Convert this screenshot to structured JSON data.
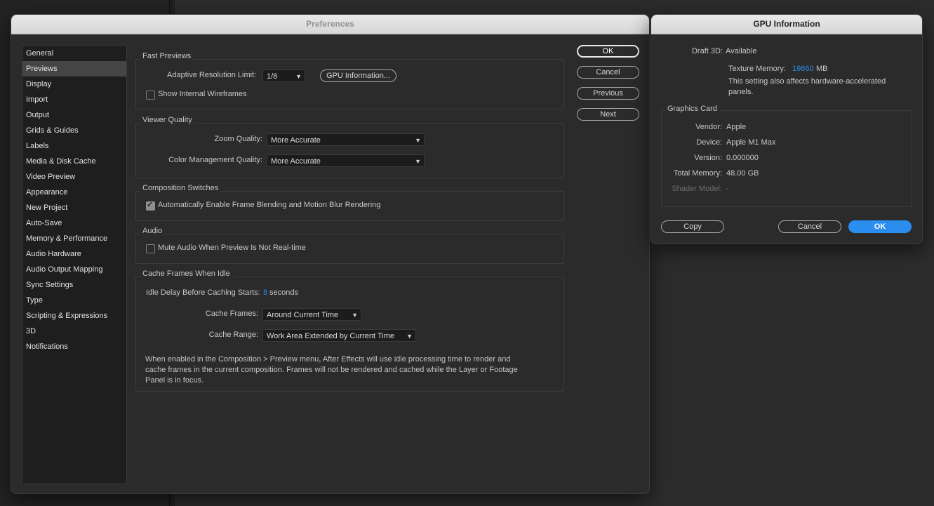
{
  "prefs": {
    "title": "Preferences",
    "sidebar": [
      "General",
      "Previews",
      "Display",
      "Import",
      "Output",
      "Grids & Guides",
      "Labels",
      "Media & Disk Cache",
      "Video Preview",
      "Appearance",
      "New Project",
      "Auto-Save",
      "Memory & Performance",
      "Audio Hardware",
      "Audio Output Mapping",
      "Sync Settings",
      "Type",
      "Scripting & Expressions",
      "3D",
      "Notifications"
    ],
    "selected_item": "Previews",
    "buttons": {
      "ok": "OK",
      "cancel": "Cancel",
      "previous": "Previous",
      "next": "Next"
    },
    "fast_previews": {
      "title": "Fast Previews",
      "adaptive_label": "Adaptive Resolution Limit:",
      "adaptive_value": "1/8",
      "gpu_info_button": "GPU Information...",
      "wireframes_label": "Show Internal Wireframes",
      "wireframes_checked": false
    },
    "viewer_quality": {
      "title": "Viewer Quality",
      "zoom_label": "Zoom Quality:",
      "zoom_value": "More Accurate",
      "color_label": "Color Management Quality:",
      "color_value": "More Accurate"
    },
    "comp_switches": {
      "title": "Composition Switches",
      "frame_blending_label": "Automatically Enable Frame Blending and Motion Blur Rendering",
      "frame_blending_checked": true
    },
    "audio": {
      "title": "Audio",
      "mute_label": "Mute Audio When Preview Is Not Real-time",
      "mute_checked": false
    },
    "cache": {
      "title": "Cache Frames When Idle",
      "idle_label": "Idle Delay Before Caching Starts:",
      "idle_value": "8",
      "idle_unit": "seconds",
      "frames_label": "Cache Frames:",
      "frames_value": "Around Current Time",
      "range_label": "Cache Range:",
      "range_value": "Work Area Extended by Current Time",
      "note_line1": "When enabled in the Composition > Preview menu, After Effects will use idle processing time to render and",
      "note_line2": "cache frames in the current composition. Frames will not be rendered and cached while the Layer or Footage",
      "note_line3": "Panel is in focus."
    }
  },
  "gpu": {
    "title": "GPU Information",
    "draft_label": "Draft 3D:",
    "draft_value": "Available",
    "texture_label": "Texture Memory:",
    "texture_value": "19660",
    "texture_unit": "MB",
    "texture_note_1": "This setting also affects hardware-accelerated",
    "texture_note_2": "panels.",
    "card_title": "Graphics Card",
    "vendor_label": "Vendor:",
    "vendor_value": "Apple",
    "device_label": "Device:",
    "device_value": "Apple M1 Max",
    "version_label": "Version:",
    "version_value": "0.000000",
    "total_label": "Total Memory:",
    "total_value": "48.00 GB",
    "shader_label": "Shader Model:",
    "shader_value": "-",
    "buttons": {
      "copy": "Copy",
      "cancel": "Cancel",
      "ok": "OK"
    }
  },
  "colors": {
    "accent": "#2d8ceb",
    "ok_blue": "#2b8df0"
  }
}
